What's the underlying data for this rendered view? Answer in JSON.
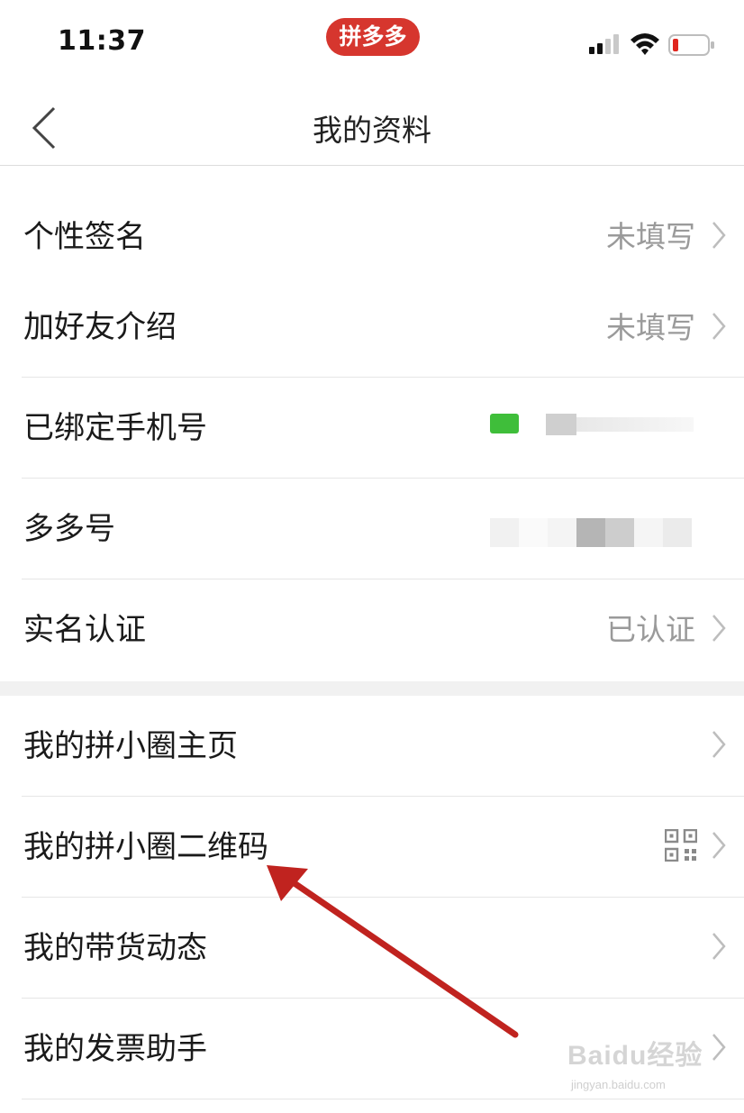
{
  "status_bar": {
    "time": "11:37",
    "app_badge": "拼多多"
  },
  "nav": {
    "title": "我的资料"
  },
  "rows": [
    {
      "label": "个性签名",
      "value": "未填写"
    },
    {
      "label": "加好友介绍",
      "value": "未填写"
    },
    {
      "label": "已绑定手机号",
      "value": ""
    },
    {
      "label": "多多号",
      "value": ""
    },
    {
      "label": "实名认证",
      "value": "已认证"
    },
    {
      "label": "我的拼小圈主页",
      "value": ""
    },
    {
      "label": "我的拼小圈二维码",
      "value": ""
    },
    {
      "label": "我的带货动态",
      "value": ""
    },
    {
      "label": "我的发票助手",
      "value": ""
    }
  ],
  "watermark": {
    "main": "Baidu经验",
    "sub": "jingyan.baidu.com"
  },
  "colors": {
    "badge": "#d6362e",
    "arrow": "#c0231f",
    "section_gap": "#f1f1f1"
  },
  "icons": [
    "back-chevron-icon",
    "signal-icon",
    "wifi-icon",
    "battery-icon",
    "chevron-right-icon",
    "qr-code-icon"
  ]
}
